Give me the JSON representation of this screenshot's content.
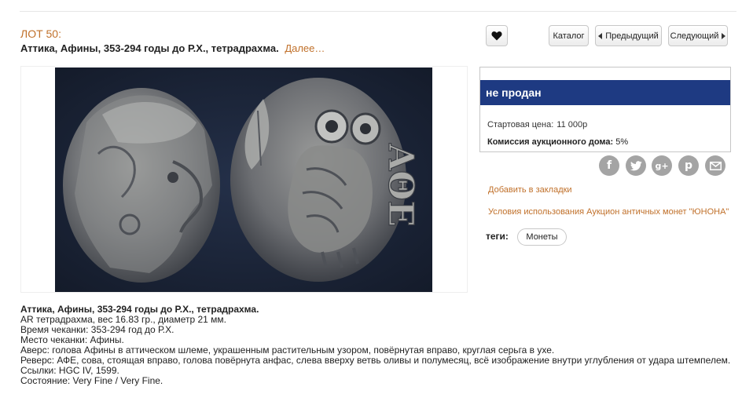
{
  "lot": {
    "number_label": "ЛОТ 50:",
    "title": "Аттика, Афины, 353-294 годы до Р.Х., тетрадрахма.",
    "more_link": "Далее…"
  },
  "nav": {
    "favorite_icon": "heart-icon",
    "catalog": "Каталог",
    "previous": "Предыдущий",
    "next": "Следующий"
  },
  "photo": {
    "obverse": "helmeted-athena-head",
    "reverse_legend": "ΑΘΕ"
  },
  "status": {
    "text": "не продан",
    "start_price_label": "Стартовая цена:",
    "start_price_value": "11 000р",
    "commission_label": "Комиссия аукционного дома:",
    "commission_value": "5%",
    "bar_color": "#1e3a82"
  },
  "share": {
    "icons": [
      "facebook-icon",
      "twitter-icon",
      "google-plus-icon",
      "pinterest-icon",
      "email-icon"
    ]
  },
  "links": {
    "bookmark": "Добавить в закладки",
    "terms": "Условия использования Аукцион античных монет \"ЮНОНА\""
  },
  "tags": {
    "label": "теги:",
    "items": [
      "Монеты"
    ]
  },
  "description": {
    "title": "Аттика, Афины, 353-294 годы до Р.Х., тетрадрахма.",
    "lines": [
      "AR тетрадрахма, вес 16.83 гр., диаметр 21 мм.",
      "Время чеканки: 353-294 год до Р.Х.",
      "Место чеканки: Афины.",
      "Аверс: голова Афины в аттическом шлеме, украшенным растительным узором, повёрнутая вправо, круглая серьга в ухе.",
      "Реверс: АФЕ, сова, стоящая вправо, голова повёрнута анфас, слева вверху ветвь оливы и полумесяц, всё изображение внутри углубления от удара штемпелем.",
      "Ссылки: HGC IV, 1599.",
      "Состояние: Very Fine / Very Fine."
    ]
  },
  "colors": {
    "accent": "#c0702a",
    "photo_background": "#1a2436"
  }
}
